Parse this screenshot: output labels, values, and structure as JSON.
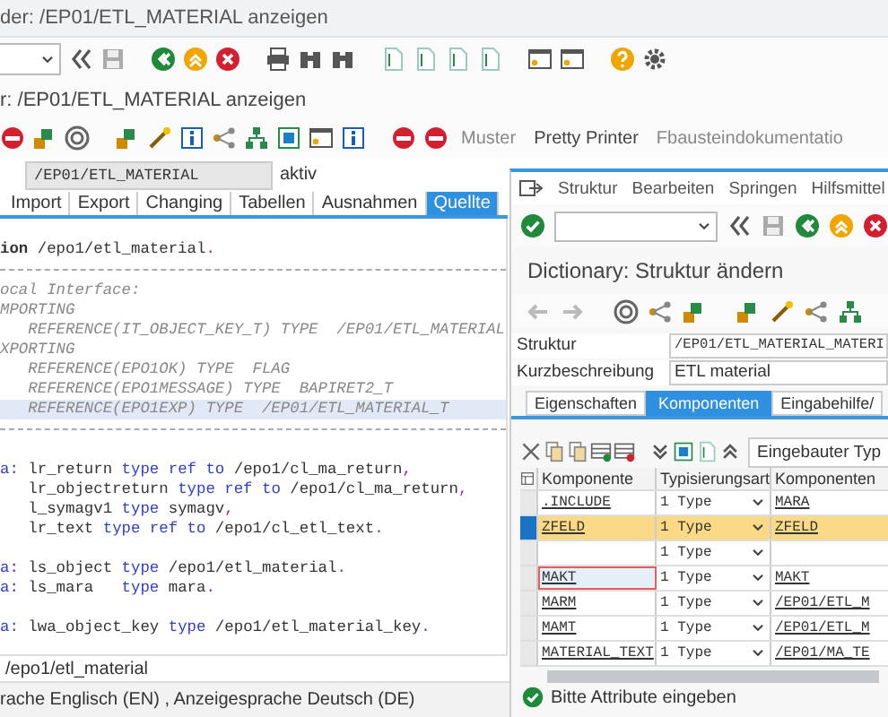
{
  "window": {
    "title": "der: /EP01/ETL_MATERIAL anzeigen"
  },
  "screen_title": "r: /EP01/ETL_MATERIAL anzeigen",
  "app_toolbar": {
    "buttons": [
      "Muster",
      "Pretty Printer",
      "Fbausteindokumentatio"
    ]
  },
  "function_module": {
    "value": "/EP01/ETL_MATERIAL",
    "status": "aktiv"
  },
  "tabs": [
    {
      "label": "Import",
      "selected": false
    },
    {
      "label": "Export",
      "selected": false
    },
    {
      "label": "Changing",
      "selected": false
    },
    {
      "label": "Tabellen",
      "selected": false
    },
    {
      "label": "Ausnahmen",
      "selected": false
    },
    {
      "label": "Quellte",
      "selected": true
    }
  ],
  "code_lines": [
    {
      "kind": "code",
      "highlighted": false,
      "segments": [
        {
          "kind": "bold",
          "text": "ion"
        },
        {
          "kind": "plain",
          "text": " /epo1/etl_material"
        },
        {
          "kind": "punct",
          "text": "."
        }
      ]
    },
    {
      "kind": "rule"
    },
    {
      "kind": "code",
      "highlighted": false,
      "segments": [
        {
          "kind": "comment",
          "text": "ocal Interface:"
        }
      ]
    },
    {
      "kind": "code",
      "highlighted": false,
      "segments": [
        {
          "kind": "comment",
          "text": "MPORTING"
        }
      ]
    },
    {
      "kind": "code",
      "highlighted": false,
      "segments": [
        {
          "kind": "comment",
          "text": "   REFERENCE(IT_OBJECT_KEY_T) TYPE  /EP01/ETL_MATERIAL"
        }
      ]
    },
    {
      "kind": "code",
      "highlighted": false,
      "segments": [
        {
          "kind": "comment",
          "text": "XPORTING"
        }
      ]
    },
    {
      "kind": "code",
      "highlighted": false,
      "segments": [
        {
          "kind": "comment",
          "text": "   REFERENCE(EPO1OK) TYPE  FLAG"
        }
      ]
    },
    {
      "kind": "code",
      "highlighted": false,
      "segments": [
        {
          "kind": "comment",
          "text": "   REFERENCE(EPO1MESSAGE) TYPE  BAPIRET2_T"
        }
      ]
    },
    {
      "kind": "code",
      "highlighted": true,
      "segments": [
        {
          "kind": "comment",
          "text": "   REFERENCE(EPO1EXP) TYPE  /EP01/ETL_MATERIAL_T"
        }
      ]
    },
    {
      "kind": "rule"
    },
    {
      "kind": "blank"
    },
    {
      "kind": "code",
      "highlighted": false,
      "segments": [
        {
          "kind": "keyword",
          "text": "a:"
        },
        {
          "kind": "plain",
          "text": " lr_return "
        },
        {
          "kind": "keyword",
          "text": "type ref to"
        },
        {
          "kind": "plain",
          "text": " /epo1/cl_ma_return"
        },
        {
          "kind": "punct",
          "text": ","
        }
      ]
    },
    {
      "kind": "code",
      "highlighted": false,
      "segments": [
        {
          "kind": "plain",
          "text": "   lr_objectreturn "
        },
        {
          "kind": "keyword",
          "text": "type ref to"
        },
        {
          "kind": "plain",
          "text": " /epo1/cl_ma_return"
        },
        {
          "kind": "punct",
          "text": ","
        }
      ]
    },
    {
      "kind": "code",
      "highlighted": false,
      "segments": [
        {
          "kind": "plain",
          "text": "   l_symagv1 "
        },
        {
          "kind": "keyword",
          "text": "type"
        },
        {
          "kind": "plain",
          "text": " symagv"
        },
        {
          "kind": "punct",
          "text": ","
        }
      ]
    },
    {
      "kind": "code",
      "highlighted": false,
      "segments": [
        {
          "kind": "plain",
          "text": "   lr_text "
        },
        {
          "kind": "keyword",
          "text": "type ref to"
        },
        {
          "kind": "plain",
          "text": " /epo1/cl_etl_text"
        },
        {
          "kind": "punct",
          "text": "."
        }
      ]
    },
    {
      "kind": "blank"
    },
    {
      "kind": "code",
      "highlighted": false,
      "segments": [
        {
          "kind": "keyword",
          "text": "a:"
        },
        {
          "kind": "plain",
          "text": " ls_object "
        },
        {
          "kind": "keyword",
          "text": "type"
        },
        {
          "kind": "plain",
          "text": " /epo1/etl_material"
        },
        {
          "kind": "punct",
          "text": "."
        }
      ]
    },
    {
      "kind": "code",
      "highlighted": false,
      "segments": [
        {
          "kind": "keyword",
          "text": "a:"
        },
        {
          "kind": "plain",
          "text": " ls_mara   "
        },
        {
          "kind": "keyword",
          "text": "type"
        },
        {
          "kind": "plain",
          "text": " mara"
        },
        {
          "kind": "punct",
          "text": "."
        }
      ]
    },
    {
      "kind": "blank"
    },
    {
      "kind": "code",
      "highlighted": false,
      "segments": [
        {
          "kind": "keyword",
          "text": "a:"
        },
        {
          "kind": "plain",
          "text": " lwa_object_key "
        },
        {
          "kind": "keyword",
          "text": "type"
        },
        {
          "kind": "plain",
          "text": " /epo1/etl_material_key"
        },
        {
          "kind": "punct",
          "text": "."
        }
      ]
    }
  ],
  "footer_field": "/epo1/etl_material",
  "status_bar": "rache Englisch (EN) , Anzeigesprache Deutsch (DE)",
  "popup": {
    "menu": [
      "Struktur",
      "Bearbeiten",
      "Springen",
      "Hilfsmittel"
    ],
    "title": "Dictionary: Struktur ändern",
    "fields": [
      {
        "label": "Struktur",
        "value": "/EP01/ETL_MATERIAL_MATERI"
      },
      {
        "label": "Kurzbeschreibung",
        "value": "ETL material"
      }
    ],
    "tabs": [
      {
        "label": "Eigenschaften",
        "selected": false
      },
      {
        "label": "Komponenten",
        "selected": true
      },
      {
        "label": "Eingabehilfe/",
        "selected": false
      }
    ],
    "table_toolbar_button": "Eingebauter Typ",
    "table": {
      "columns": [
        "Komponente",
        "Typisierungsart",
        "Komponenten"
      ],
      "rows": [
        {
          "cells": [
            ".INCLUDE",
            "1 Type",
            "MARA"
          ],
          "selected": false,
          "focused": false
        },
        {
          "cells": [
            "ZFELD",
            "1 Type",
            "ZFELD"
          ],
          "selected": true,
          "focused": false
        },
        {
          "cells": [
            "",
            "1 Type",
            ""
          ],
          "selected": false,
          "focused": false
        },
        {
          "cells": [
            "MAKT",
            "1 Type",
            "MAKT"
          ],
          "selected": false,
          "focused": true
        },
        {
          "cells": [
            "MARM",
            "1 Type",
            "/EP01/ETL_M"
          ],
          "selected": false,
          "focused": false
        },
        {
          "cells": [
            "MAMT",
            "1 Type",
            "/EP01/ETL_M"
          ],
          "selected": false,
          "focused": false
        },
        {
          "cells": [
            "MATERIAL_TEXT",
            "1 Type",
            "/EP01/MA_TE"
          ],
          "selected": false,
          "focused": false
        }
      ]
    },
    "status": {
      "kind": "success",
      "text": "Bitte Attribute eingeben"
    }
  }
}
